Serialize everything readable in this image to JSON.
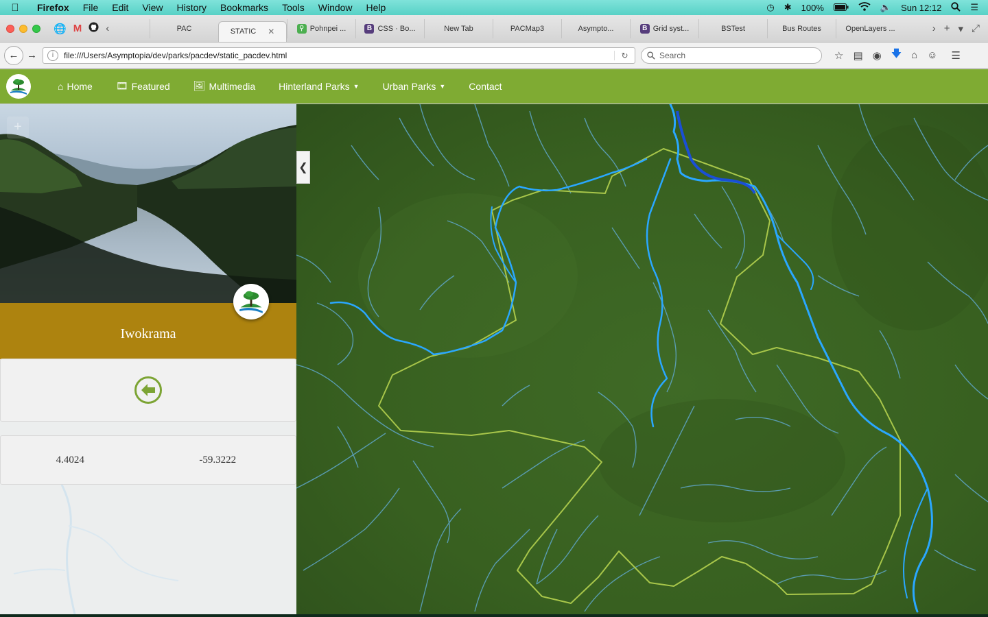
{
  "menubar": {
    "app_name": "Firefox",
    "menus": [
      "File",
      "Edit",
      "View",
      "History",
      "Bookmarks",
      "Tools",
      "Window",
      "Help"
    ],
    "battery": "100%",
    "clock": "Sun 12:12"
  },
  "tabs": [
    {
      "label": "PAC",
      "favicon": "none"
    },
    {
      "label": "STATIC",
      "favicon": "none",
      "active": true
    },
    {
      "label": "Pohnpei ...",
      "favicon": "maps-icon"
    },
    {
      "label": "CSS · Bo...",
      "favicon": "bootstrap-icon"
    },
    {
      "label": "New Tab",
      "favicon": "none"
    },
    {
      "label": "PACMap3",
      "favicon": "none"
    },
    {
      "label": "Asympto...",
      "favicon": "none"
    },
    {
      "label": "Grid syst...",
      "favicon": "bootstrap-icon"
    },
    {
      "label": "BSTest",
      "favicon": "none"
    },
    {
      "label": "Bus Routes",
      "favicon": "none"
    },
    {
      "label": "OpenLayers ...",
      "favicon": "none"
    }
  ],
  "navbar": {
    "url": "file:///Users/Asymptopia/dev/parks/pacdev/static_pacdev.html",
    "search_placeholder": "Search"
  },
  "site": {
    "nav": {
      "home": "Home",
      "featured": "Featured",
      "multimedia": "Multimedia",
      "hinterland": "Hinterland Parks",
      "urban": "Urban Parks",
      "contact": "Contact"
    }
  },
  "park": {
    "name": "Iwokrama",
    "latitude": "4.4024",
    "longitude": "-59.3222"
  },
  "map": {
    "zoom_in_label": "+"
  },
  "colors": {
    "header_green": "#7fab33",
    "title_gold": "#ad830f",
    "river_blue": "#2aa7ff",
    "boundary": "#a8c64a"
  }
}
